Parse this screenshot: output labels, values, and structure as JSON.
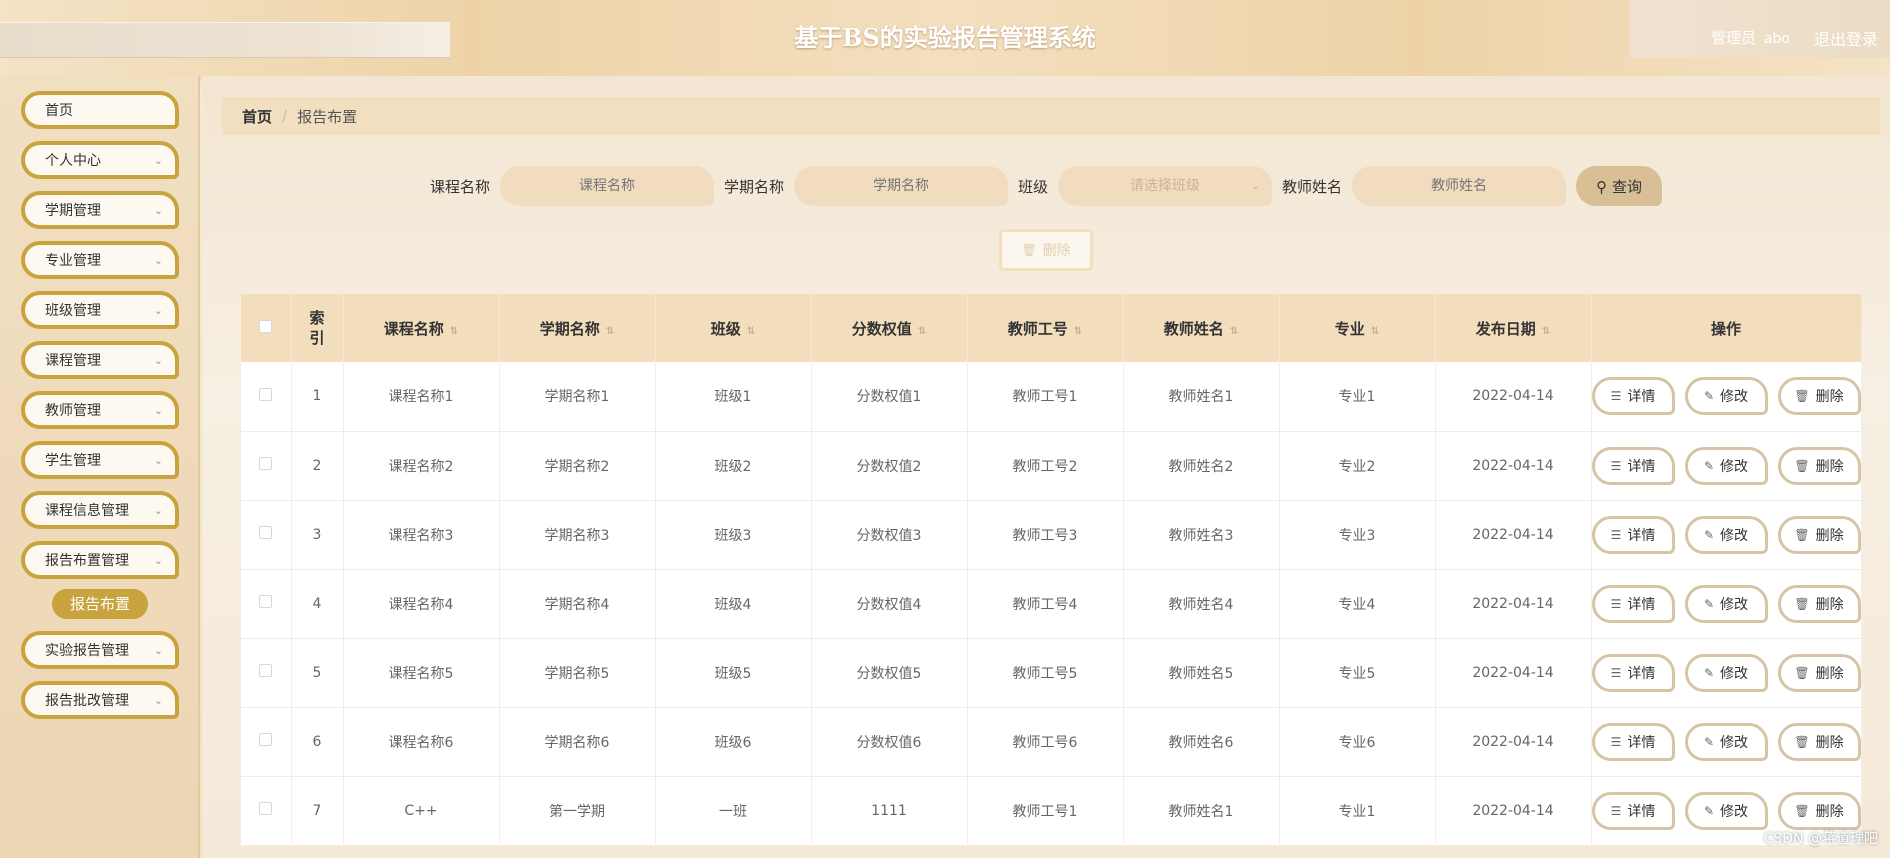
{
  "header": {
    "title": "基于BS的实验报告管理系统",
    "user_role": "管理员",
    "user_name": "abo",
    "logout": "退出登录"
  },
  "sidebar": {
    "items": [
      {
        "label": "首页",
        "has_arrow": false
      },
      {
        "label": "个人中心",
        "has_arrow": true
      },
      {
        "label": "学期管理",
        "has_arrow": true
      },
      {
        "label": "专业管理",
        "has_arrow": true
      },
      {
        "label": "班级管理",
        "has_arrow": true
      },
      {
        "label": "课程管理",
        "has_arrow": true
      },
      {
        "label": "教师管理",
        "has_arrow": true
      },
      {
        "label": "学生管理",
        "has_arrow": true
      },
      {
        "label": "课程信息管理",
        "has_arrow": true
      },
      {
        "label": "报告布置管理",
        "has_arrow": true
      }
    ],
    "active_sub": "报告布置",
    "items_after": [
      {
        "label": "实验报告管理",
        "has_arrow": true
      },
      {
        "label": "报告批改管理",
        "has_arrow": true
      }
    ]
  },
  "breadcrumb": {
    "home": "首页",
    "sep": "/",
    "current": "报告布置"
  },
  "search": {
    "course_label": "课程名称",
    "course_placeholder": "课程名称",
    "term_label": "学期名称",
    "term_placeholder": "学期名称",
    "class_label": "班级",
    "class_placeholder": "请选择班级",
    "teacher_label": "教师姓名",
    "teacher_placeholder": "教师姓名",
    "query_button": "查询"
  },
  "batch_delete": "删除",
  "table": {
    "columns": [
      "索引",
      "课程名称",
      "学期名称",
      "班级",
      "分数权值",
      "教师工号",
      "教师姓名",
      "专业",
      "发布日期",
      "操作"
    ],
    "rows": [
      [
        "1",
        "课程名称1",
        "学期名称1",
        "班级1",
        "分数权值1",
        "教师工号1",
        "教师姓名1",
        "专业1",
        "2022-04-14"
      ],
      [
        "2",
        "课程名称2",
        "学期名称2",
        "班级2",
        "分数权值2",
        "教师工号2",
        "教师姓名2",
        "专业2",
        "2022-04-14"
      ],
      [
        "3",
        "课程名称3",
        "学期名称3",
        "班级3",
        "分数权值3",
        "教师工号3",
        "教师姓名3",
        "专业3",
        "2022-04-14"
      ],
      [
        "4",
        "课程名称4",
        "学期名称4",
        "班级4",
        "分数权值4",
        "教师工号4",
        "教师姓名4",
        "专业4",
        "2022-04-14"
      ],
      [
        "5",
        "课程名称5",
        "学期名称5",
        "班级5",
        "分数权值5",
        "教师工号5",
        "教师姓名5",
        "专业5",
        "2022-04-14"
      ],
      [
        "6",
        "课程名称6",
        "学期名称6",
        "班级6",
        "分数权值6",
        "教师工号6",
        "教师姓名6",
        "专业6",
        "2022-04-14"
      ],
      [
        "7",
        "C++",
        "第一学期",
        "一班",
        "1111",
        "教师工号1",
        "教师姓名1",
        "专业1",
        "2022-04-14"
      ]
    ],
    "actions": {
      "detail": "详情",
      "edit": "修改",
      "delete": "删除"
    }
  },
  "watermark": "CSDN @蒋道理吧",
  "colors": {
    "accent": "#c9a33e",
    "header_bg": "#f2ddbd"
  }
}
